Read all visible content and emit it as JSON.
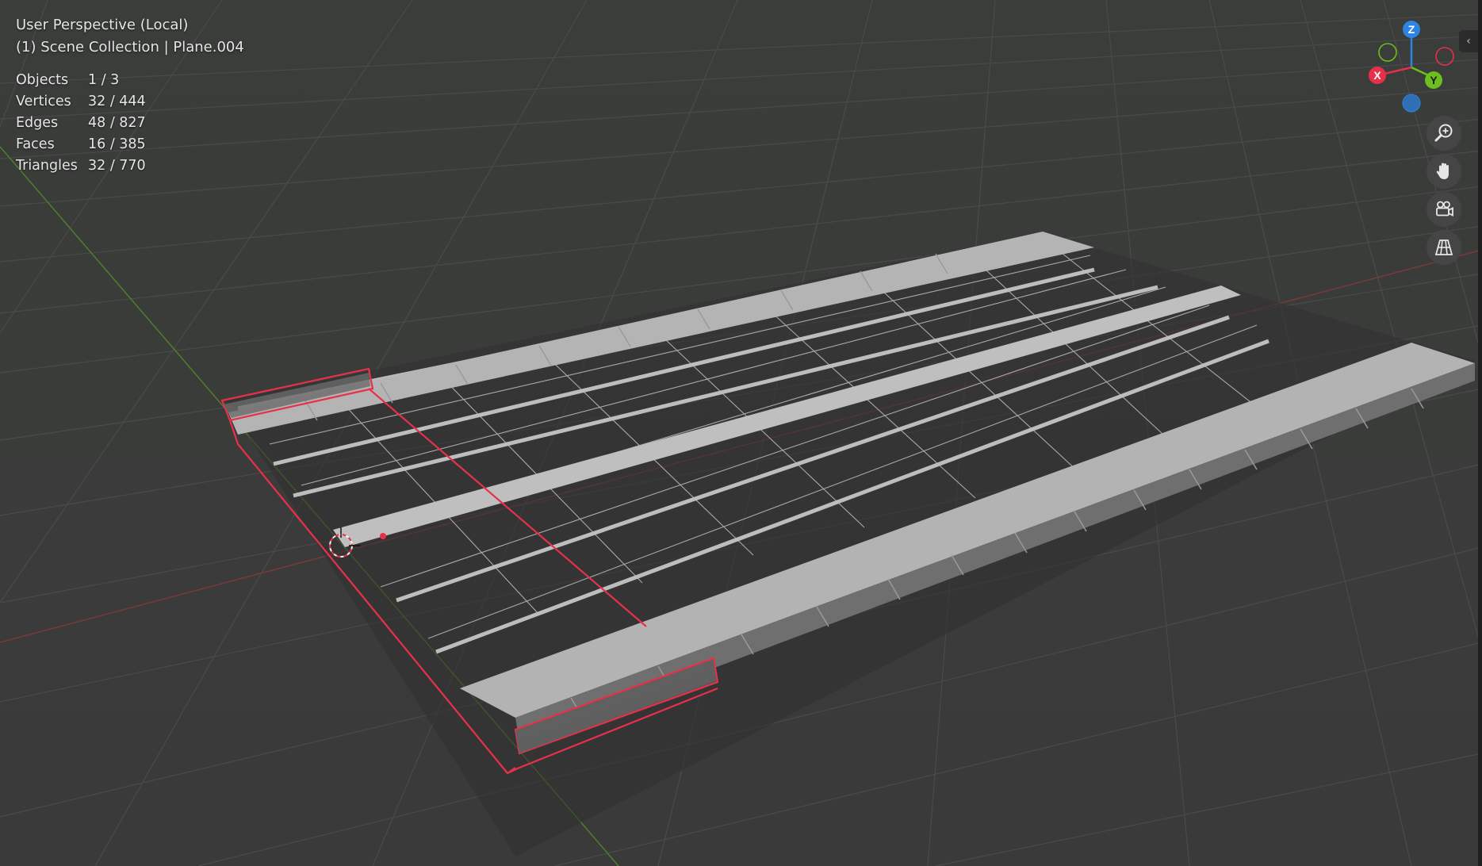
{
  "viewport": {
    "view_name": "User Perspective (Local)",
    "collection_line": "(1) Scene Collection | Plane.004"
  },
  "stats": [
    {
      "label": "Objects",
      "value": "1 / 3"
    },
    {
      "label": "Vertices",
      "value": "32 / 444"
    },
    {
      "label": "Edges",
      "value": "48 / 827"
    },
    {
      "label": "Faces",
      "value": "16 / 385"
    },
    {
      "label": "Triangles",
      "value": "32 / 770"
    }
  ],
  "gizmo": {
    "axes": [
      {
        "name": "Z",
        "color": "#2f83e3"
      },
      {
        "name": "X",
        "color": "#e8304a"
      },
      {
        "name": "Y",
        "color": "#6cbf1c"
      }
    ]
  },
  "nav_tools": [
    {
      "name": "zoom-icon"
    },
    {
      "name": "pan-hand-icon"
    },
    {
      "name": "camera-view-icon"
    },
    {
      "name": "orthographic-toggle-icon"
    }
  ],
  "colors": {
    "background": "#3d3d3d",
    "grid": "#474747",
    "selection": "#e8304a",
    "mesh_face": "#a8a8a8"
  }
}
